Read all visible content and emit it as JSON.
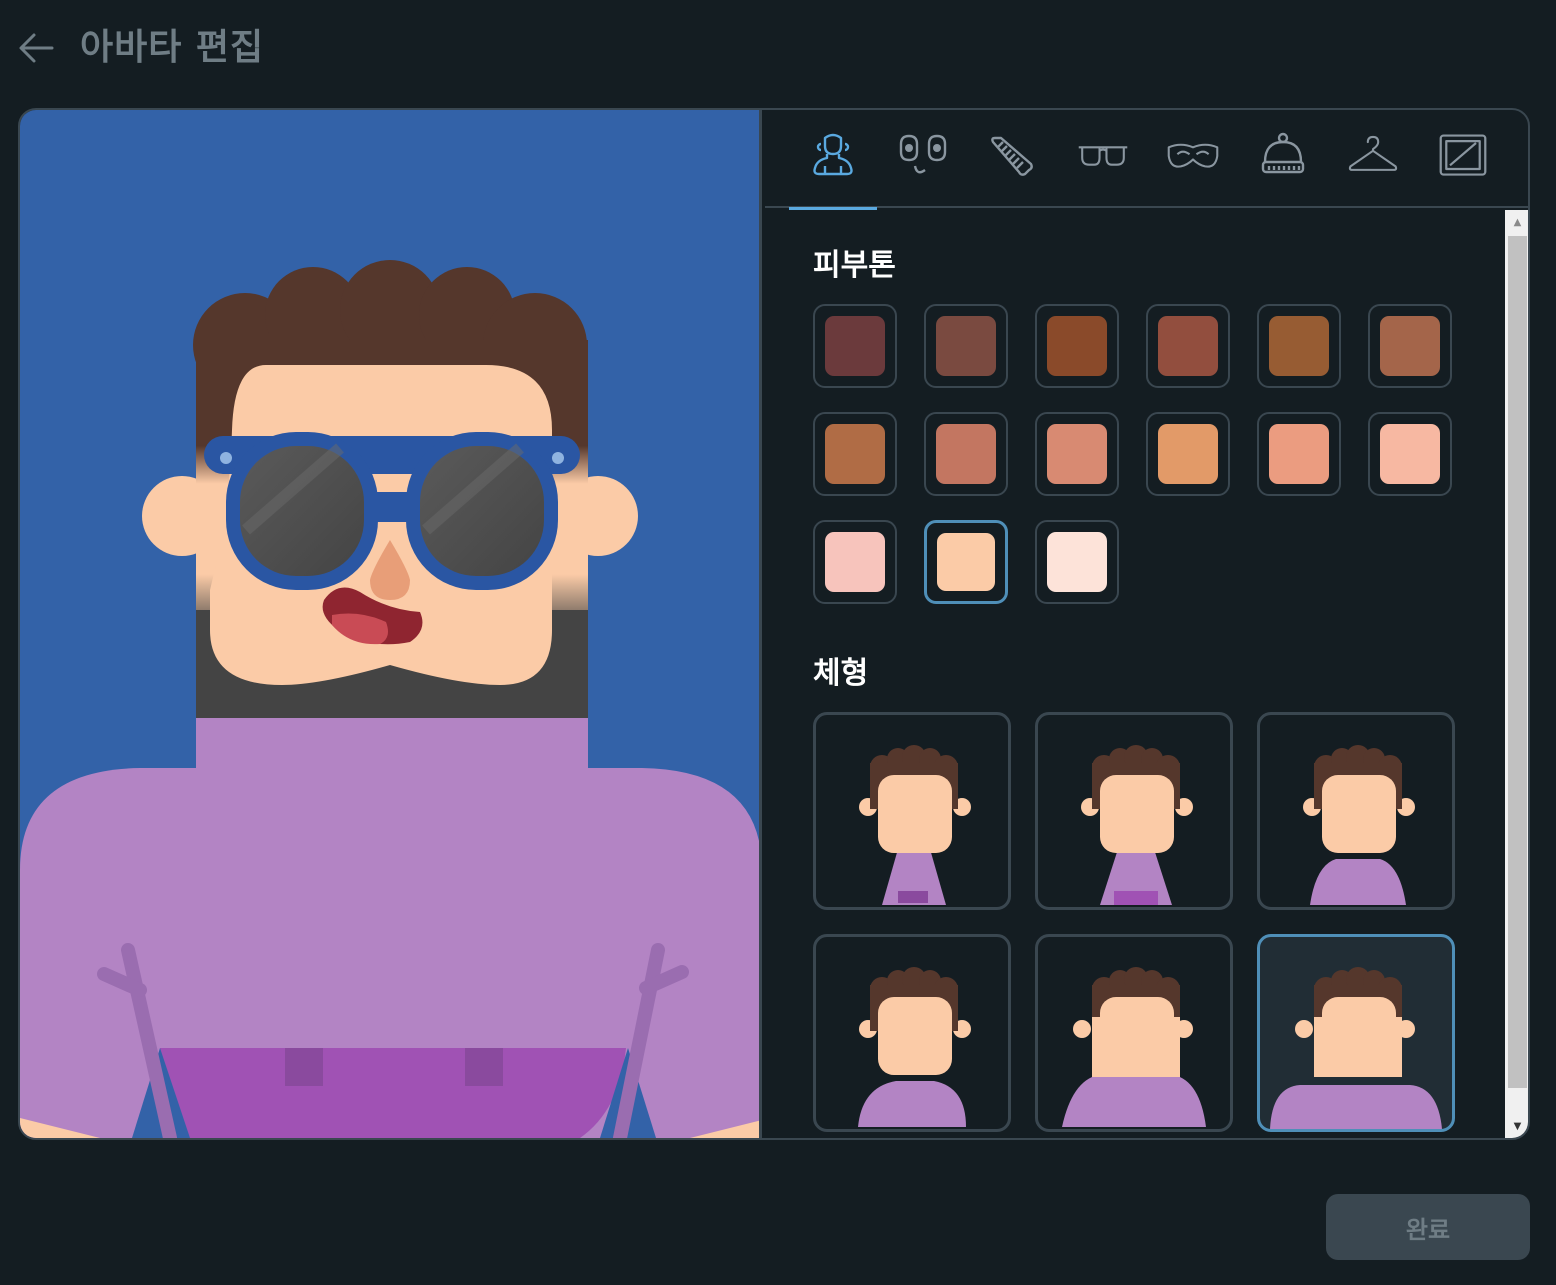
{
  "header": {
    "title": "아바타 편집",
    "back_icon": "arrow-left-icon"
  },
  "tabs": [
    {
      "name": "body",
      "icon": "body-icon",
      "active": true
    },
    {
      "name": "face",
      "icon": "face-icon",
      "active": false
    },
    {
      "name": "hair",
      "icon": "comb-icon",
      "active": false
    },
    {
      "name": "eyewear",
      "icon": "glasses-icon",
      "active": false
    },
    {
      "name": "facial-hair",
      "icon": "mustache-icon",
      "active": false
    },
    {
      "name": "headwear",
      "icon": "beanie-icon",
      "active": false
    },
    {
      "name": "clothing",
      "icon": "hanger-icon",
      "active": false
    },
    {
      "name": "background",
      "icon": "frame-icon",
      "active": false
    }
  ],
  "sections": {
    "skin_tone": {
      "title": "피부톤",
      "colors": [
        "#6b3a3c",
        "#7a4a40",
        "#8a4a2a",
        "#924e3e",
        "#975c33",
        "#a4654a",
        "#b06c45",
        "#c37661",
        "#d88a72",
        "#e29a68",
        "#eb9c80",
        "#f7b8a2",
        "#f7c4bc",
        "#fbcba7",
        "#fde3d9"
      ],
      "selected_index": 13
    },
    "body_type": {
      "title": "체형",
      "options_count": 6,
      "selected_index": 5
    }
  },
  "buttons": {
    "done_label": "완료"
  },
  "colors": {
    "background": "#141d22",
    "preview_bg": "#3362a8",
    "accent": "#5aa9e0",
    "selected_border": "#4f8fb8",
    "skin": "#fbcba7",
    "hair": "#55372c",
    "shirt": "#b384c4",
    "beard": "#444444",
    "glasses_frame": "#2a56a3"
  }
}
